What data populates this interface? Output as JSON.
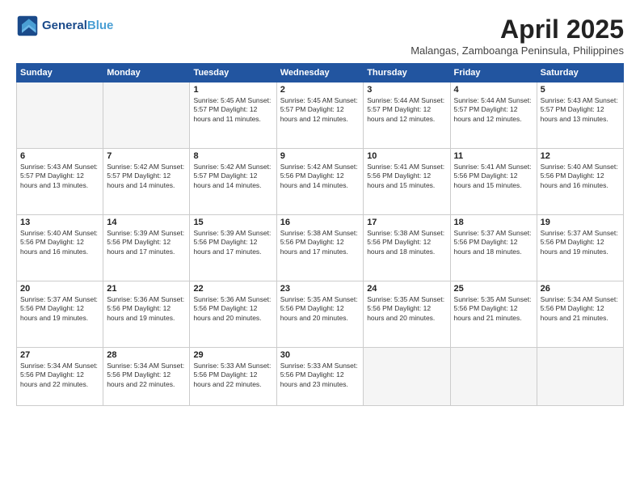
{
  "header": {
    "logo_line1": "General",
    "logo_line2": "Blue",
    "month_title": "April 2025",
    "subtitle": "Malangas, Zamboanga Peninsula, Philippines"
  },
  "weekdays": [
    "Sunday",
    "Monday",
    "Tuesday",
    "Wednesday",
    "Thursday",
    "Friday",
    "Saturday"
  ],
  "weeks": [
    [
      {
        "day": "",
        "info": ""
      },
      {
        "day": "",
        "info": ""
      },
      {
        "day": "1",
        "info": "Sunrise: 5:45 AM\nSunset: 5:57 PM\nDaylight: 12 hours\nand 11 minutes."
      },
      {
        "day": "2",
        "info": "Sunrise: 5:45 AM\nSunset: 5:57 PM\nDaylight: 12 hours\nand 12 minutes."
      },
      {
        "day": "3",
        "info": "Sunrise: 5:44 AM\nSunset: 5:57 PM\nDaylight: 12 hours\nand 12 minutes."
      },
      {
        "day": "4",
        "info": "Sunrise: 5:44 AM\nSunset: 5:57 PM\nDaylight: 12 hours\nand 12 minutes."
      },
      {
        "day": "5",
        "info": "Sunrise: 5:43 AM\nSunset: 5:57 PM\nDaylight: 12 hours\nand 13 minutes."
      }
    ],
    [
      {
        "day": "6",
        "info": "Sunrise: 5:43 AM\nSunset: 5:57 PM\nDaylight: 12 hours\nand 13 minutes."
      },
      {
        "day": "7",
        "info": "Sunrise: 5:42 AM\nSunset: 5:57 PM\nDaylight: 12 hours\nand 14 minutes."
      },
      {
        "day": "8",
        "info": "Sunrise: 5:42 AM\nSunset: 5:57 PM\nDaylight: 12 hours\nand 14 minutes."
      },
      {
        "day": "9",
        "info": "Sunrise: 5:42 AM\nSunset: 5:56 PM\nDaylight: 12 hours\nand 14 minutes."
      },
      {
        "day": "10",
        "info": "Sunrise: 5:41 AM\nSunset: 5:56 PM\nDaylight: 12 hours\nand 15 minutes."
      },
      {
        "day": "11",
        "info": "Sunrise: 5:41 AM\nSunset: 5:56 PM\nDaylight: 12 hours\nand 15 minutes."
      },
      {
        "day": "12",
        "info": "Sunrise: 5:40 AM\nSunset: 5:56 PM\nDaylight: 12 hours\nand 16 minutes."
      }
    ],
    [
      {
        "day": "13",
        "info": "Sunrise: 5:40 AM\nSunset: 5:56 PM\nDaylight: 12 hours\nand 16 minutes."
      },
      {
        "day": "14",
        "info": "Sunrise: 5:39 AM\nSunset: 5:56 PM\nDaylight: 12 hours\nand 17 minutes."
      },
      {
        "day": "15",
        "info": "Sunrise: 5:39 AM\nSunset: 5:56 PM\nDaylight: 12 hours\nand 17 minutes."
      },
      {
        "day": "16",
        "info": "Sunrise: 5:38 AM\nSunset: 5:56 PM\nDaylight: 12 hours\nand 17 minutes."
      },
      {
        "day": "17",
        "info": "Sunrise: 5:38 AM\nSunset: 5:56 PM\nDaylight: 12 hours\nand 18 minutes."
      },
      {
        "day": "18",
        "info": "Sunrise: 5:37 AM\nSunset: 5:56 PM\nDaylight: 12 hours\nand 18 minutes."
      },
      {
        "day": "19",
        "info": "Sunrise: 5:37 AM\nSunset: 5:56 PM\nDaylight: 12 hours\nand 19 minutes."
      }
    ],
    [
      {
        "day": "20",
        "info": "Sunrise: 5:37 AM\nSunset: 5:56 PM\nDaylight: 12 hours\nand 19 minutes."
      },
      {
        "day": "21",
        "info": "Sunrise: 5:36 AM\nSunset: 5:56 PM\nDaylight: 12 hours\nand 19 minutes."
      },
      {
        "day": "22",
        "info": "Sunrise: 5:36 AM\nSunset: 5:56 PM\nDaylight: 12 hours\nand 20 minutes."
      },
      {
        "day": "23",
        "info": "Sunrise: 5:35 AM\nSunset: 5:56 PM\nDaylight: 12 hours\nand 20 minutes."
      },
      {
        "day": "24",
        "info": "Sunrise: 5:35 AM\nSunset: 5:56 PM\nDaylight: 12 hours\nand 20 minutes."
      },
      {
        "day": "25",
        "info": "Sunrise: 5:35 AM\nSunset: 5:56 PM\nDaylight: 12 hours\nand 21 minutes."
      },
      {
        "day": "26",
        "info": "Sunrise: 5:34 AM\nSunset: 5:56 PM\nDaylight: 12 hours\nand 21 minutes."
      }
    ],
    [
      {
        "day": "27",
        "info": "Sunrise: 5:34 AM\nSunset: 5:56 PM\nDaylight: 12 hours\nand 22 minutes."
      },
      {
        "day": "28",
        "info": "Sunrise: 5:34 AM\nSunset: 5:56 PM\nDaylight: 12 hours\nand 22 minutes."
      },
      {
        "day": "29",
        "info": "Sunrise: 5:33 AM\nSunset: 5:56 PM\nDaylight: 12 hours\nand 22 minutes."
      },
      {
        "day": "30",
        "info": "Sunrise: 5:33 AM\nSunset: 5:56 PM\nDaylight: 12 hours\nand 23 minutes."
      },
      {
        "day": "",
        "info": ""
      },
      {
        "day": "",
        "info": ""
      },
      {
        "day": "",
        "info": ""
      }
    ]
  ]
}
